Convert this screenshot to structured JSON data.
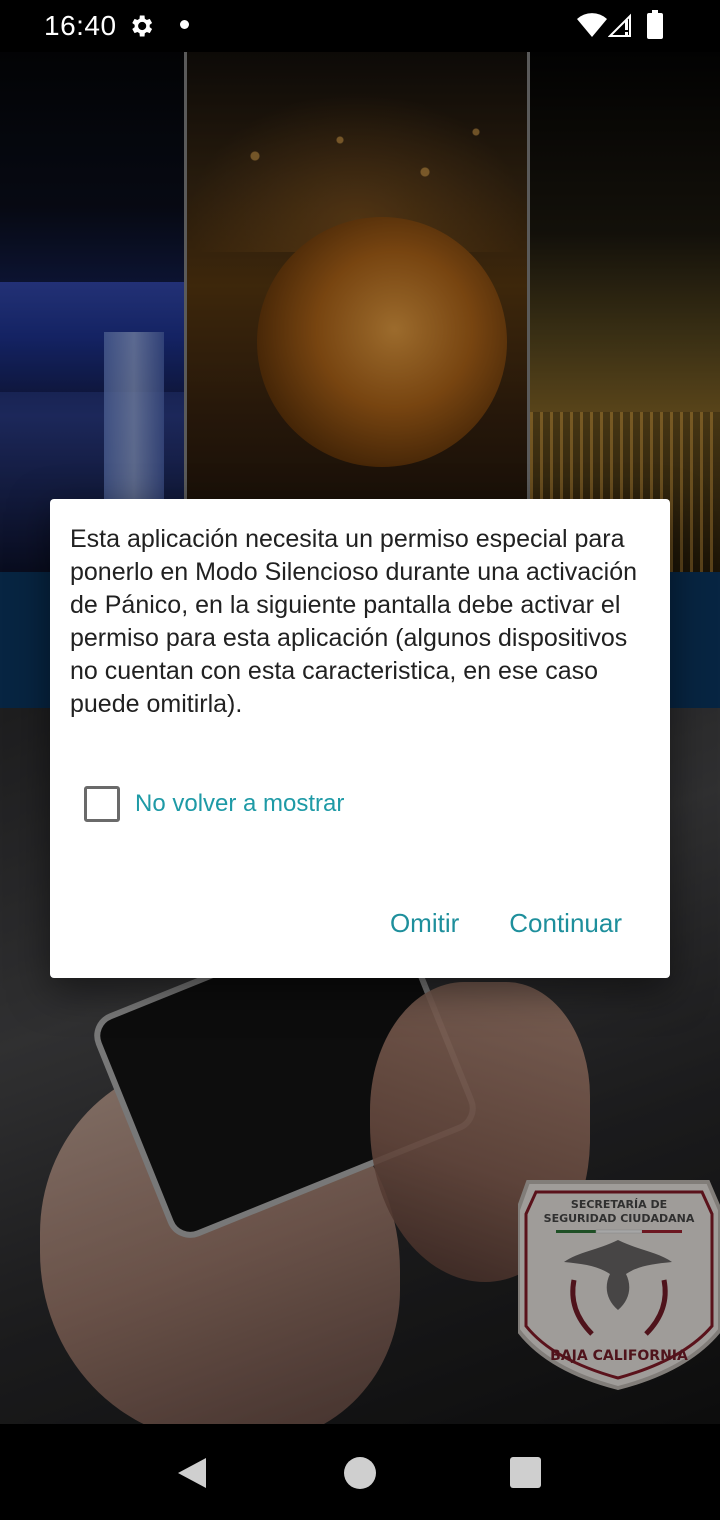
{
  "status_bar": {
    "time": "16:40",
    "icons": [
      "gear-icon",
      "notification-dot",
      "wifi-icon",
      "signal-icon",
      "battery-icon"
    ]
  },
  "background": {
    "emblem": {
      "top_text": "SECRETARÍA DE SEGURIDAD CIUDADANA",
      "bottom_text": "BAJA CALIFORNIA"
    },
    "colors": {
      "band": "#0c3a66"
    }
  },
  "dialog": {
    "message": "Esta aplicación necesita un permiso especial para ponerlo en Modo Silencioso durante una activación de Pánico, en la siguiente pantalla debe activar el permiso para esta aplicación (algunos dispositivos no cuentan con esta caracteristica, en ese caso puede omitirla).",
    "checkbox_label": "No volver a mostrar",
    "checkbox_checked": false,
    "skip_label": "Omitir",
    "continue_label": "Continuar",
    "accent_color": "#1e8f9c"
  },
  "nav_bar": {
    "icons": [
      "back-icon",
      "home-icon",
      "recents-icon"
    ]
  }
}
